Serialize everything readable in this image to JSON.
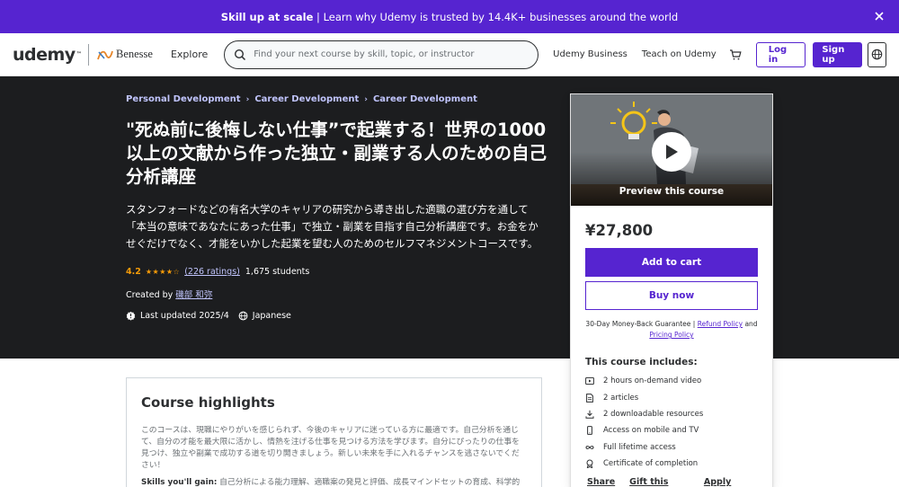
{
  "banner": {
    "bold": "Skill up at scale",
    "text": " | Learn why Udemy is trusted by 14.4K+ businesses around the world"
  },
  "header": {
    "logo": "udemy",
    "partner": "Benesse",
    "explore": "Explore",
    "search_placeholder": "Find your next course by skill, topic, or instructor",
    "udemy_business": "Udemy Business",
    "teach": "Teach on Udemy",
    "login": "Log in",
    "signup": "Sign up"
  },
  "hero": {
    "breadcrumbs": [
      "Personal Development",
      "Career Development",
      "Career Development"
    ],
    "title": "\"死ぬ前に後悔しない仕事”で起業する！世界の1000以上の文献から作った独立・副業する人のための自己分析講座",
    "subtitle": "スタンフォードなどの有名大学のキャリアの研究から導き出した適職の選び方を通して「本当の意味であなたにあった仕事」で独立・副業を目指す自己分析講座です。お金をかせぐだけでなく、才能をいかした起業を望む人のためのセルフマネジメントコースです。",
    "rating": "4.2",
    "ratings_count": "(226 ratings)",
    "students": "1,675 students",
    "created_by_label": "Created by ",
    "instructor": "磯部 和弥",
    "last_updated": "Last updated 2025/4",
    "language": "Japanese"
  },
  "card": {
    "preview_label": "Preview this course",
    "price": "¥27,800",
    "add_to_cart": "Add to cart",
    "buy_now": "Buy now",
    "guarantee_text": "30-Day Money-Back Guarantee | ",
    "refund_policy": "Refund Policy",
    "and": " and ",
    "pricing_policy": "Pricing Policy",
    "includes_title": "This course includes:",
    "includes": [
      "2 hours on-demand video",
      "2 articles",
      "2 downloadable resources",
      "Access on mobile and TV",
      "Full lifetime access",
      "Certificate of completion"
    ],
    "share": "Share",
    "gift": "Gift this course",
    "coupon": "Apply Coupon"
  },
  "highlights": {
    "title": "Course highlights",
    "body": "このコースは、現職にやりがいを感じられず、今後のキャリアに迷っている方に最適です。自己分析を通じて、自分の才能を最大限に活かし、情熱を注げる仕事を見つける方法を学びます。自分にぴったりの仕事を見つけ、独立や副業で成功する道を切り開きましょう。新しい未来を手に入れるチャンスを逃さないでください！",
    "skills_label": "Skills you'll gain:",
    "skills_text": " 自己分析による能力理解、適職案の発見と評価、成長マインドセットの育成、科学的"
  },
  "colors": {
    "brand": "#5624d0",
    "hero_bg": "#1c1d1f",
    "link_light": "#c0c4fc",
    "star": "#f69c08"
  }
}
